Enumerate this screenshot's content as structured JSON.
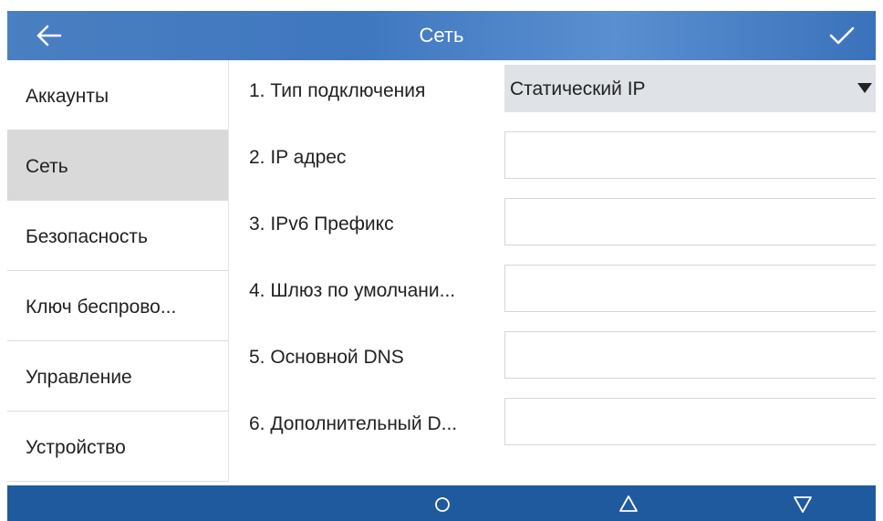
{
  "header": {
    "title": "Сеть",
    "back_icon": "arrow-left-icon",
    "confirm_icon": "checkmark-icon"
  },
  "sidebar": {
    "items": [
      {
        "label": "Аккаунты",
        "active": false
      },
      {
        "label": "Сеть",
        "active": true
      },
      {
        "label": "Безопасность",
        "active": false
      },
      {
        "label": "Ключ беспрово...",
        "active": false
      },
      {
        "label": "Управление",
        "active": false
      },
      {
        "label": "Устройство",
        "active": false
      }
    ]
  },
  "form": {
    "rows": [
      {
        "label": "1.  Тип подключения",
        "type": "select",
        "value": "Статический IP"
      },
      {
        "label": "2.  IP адрес",
        "type": "input",
        "value": ""
      },
      {
        "label": "3.  IPv6 Префикс",
        "type": "input",
        "value": ""
      },
      {
        "label": "4.  Шлюз по умолчани...",
        "type": "input",
        "value": ""
      },
      {
        "label": "5.  Основной DNS",
        "type": "input",
        "value": ""
      },
      {
        "label": "6.  Дополнительный D...",
        "type": "input",
        "value": ""
      }
    ]
  },
  "navbar": {
    "buttons": [
      "circle-home-icon",
      "triangle-up-icon",
      "triangle-down-icon"
    ]
  },
  "colors": {
    "header_blue": "#4a7fc1",
    "navbar_blue": "#1f5a9e",
    "active_item_bg": "#d9d9d9",
    "select_bg": "#dfe2e6"
  }
}
